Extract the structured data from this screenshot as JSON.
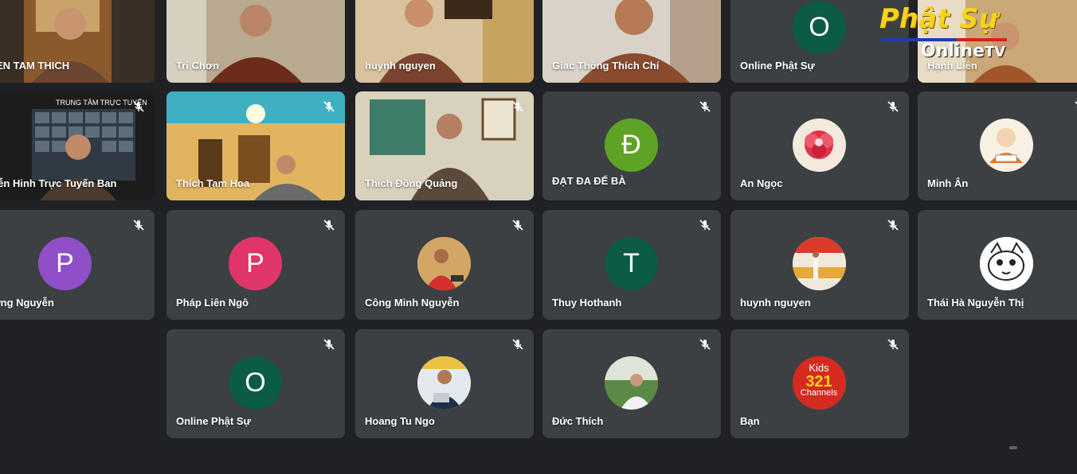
{
  "overlay_logo": {
    "line1": "Phật Sự",
    "line2": "Online",
    "line2_suffix": "TV"
  },
  "row1": [
    {
      "name": "HIEN TAM THICH",
      "active": false
    },
    {
      "name": "Tri Chơn",
      "active": false
    },
    {
      "name": "huynh nguyen",
      "active": false
    },
    {
      "name": "Giac Thông Thích Chí",
      "active": true
    },
    {
      "name": "Online Phật Sự",
      "initial": "O",
      "color": "#0b5b45"
    },
    {
      "name": "Hạnh Liên",
      "active": false
    }
  ],
  "row2": [
    {
      "name": "uyễn Hinh Trực Tuyến Ban",
      "banner": "TRUNG TÂM TRỰC TUYẾN"
    },
    {
      "name": "Thích Tam Hoa"
    },
    {
      "name": "Thích Đồng Quảng"
    },
    {
      "name": "ĐẠT ĐA ĐẾ BÀ",
      "initial": "Đ",
      "color": "#5fa326"
    },
    {
      "name": "An Ngọc",
      "avatar": "flower"
    },
    {
      "name": "Minh Ân",
      "avatar": "monk-cartoon"
    }
  ],
  "row3": [
    {
      "name": "ương Nguyễn",
      "initial": "P",
      "color": "#8e4fc8"
    },
    {
      "name": "Pháp Liên Ngô",
      "initial": "P",
      "color": "#e0356b"
    },
    {
      "name": "Công Minh Nguyễn",
      "avatar": "photo"
    },
    {
      "name": "Thuy Hothanh",
      "initial": "T",
      "color": "#0b5b45"
    },
    {
      "name": "huynh nguyen",
      "avatar": "photo"
    },
    {
      "name": "Thái Hà Nguyễn Thị",
      "avatar": "cat-cartoon"
    }
  ],
  "row4": [
    {
      "name": "Online Phật Sự",
      "initial": "O",
      "color": "#0b5b45"
    },
    {
      "name": "Hoang Tu Ngo",
      "avatar": "photo"
    },
    {
      "name": "Đức Thích",
      "avatar": "photo"
    },
    {
      "name": "Bạn",
      "avatar": "kids-channel",
      "avatar_text": "Kids",
      "avatar_num": "321",
      "avatar_sub": "Channels"
    }
  ],
  "colors": {
    "background": "#202124",
    "tile": "#3c4043",
    "active_border": "#8ab4f8"
  }
}
